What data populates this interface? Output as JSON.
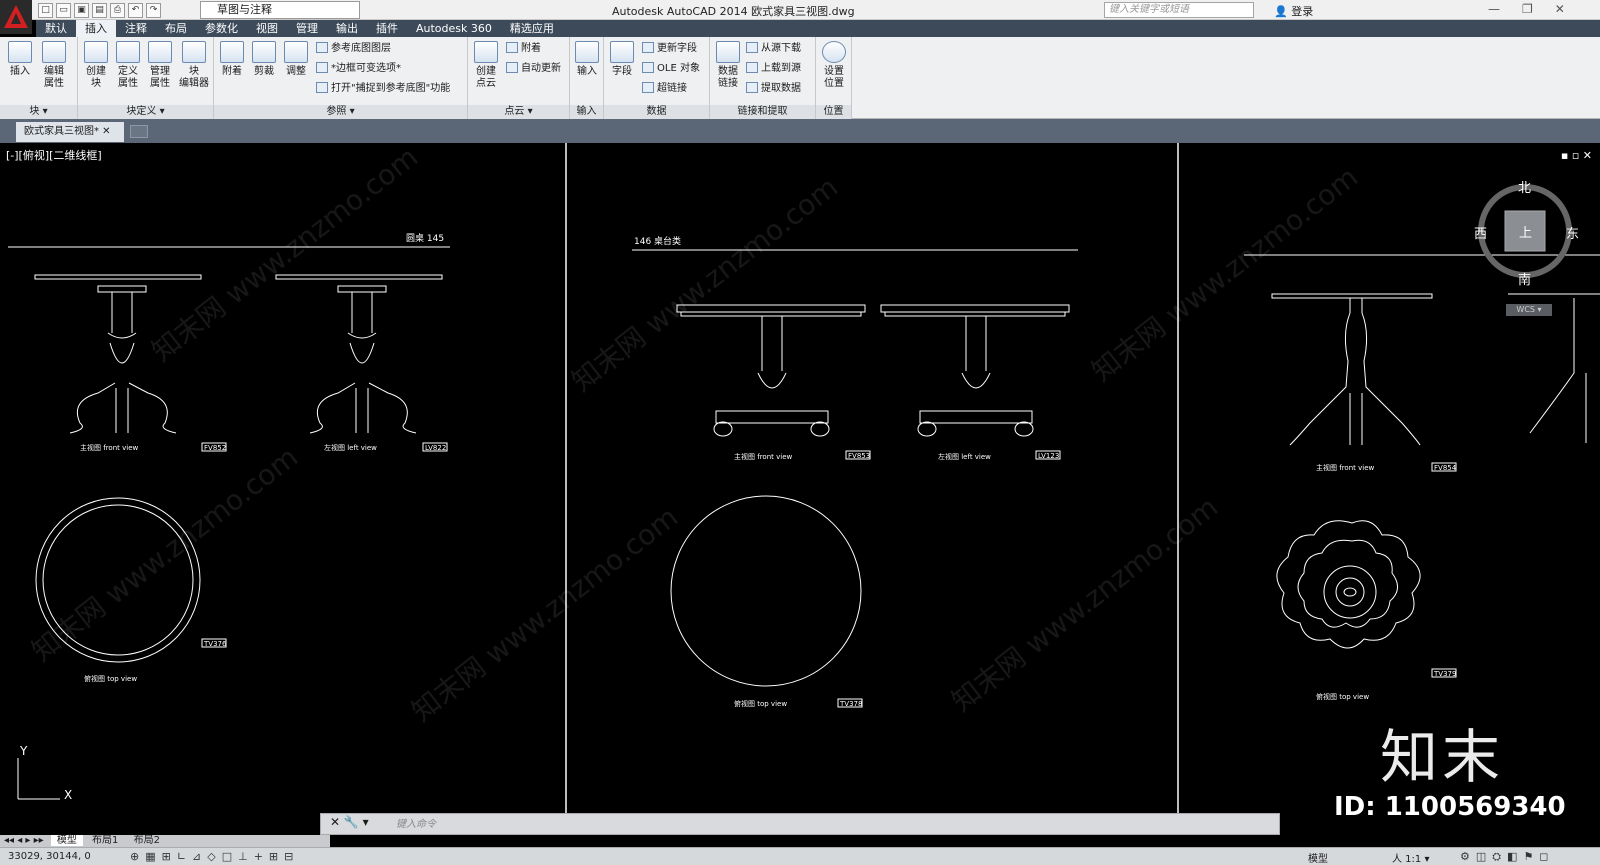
{
  "titlebar": {
    "workspace": "草图与注释",
    "app_title": "Autodesk AutoCAD 2014    欧式家具三视图.dwg",
    "search_placeholder": "键入关键字或短语",
    "login": "登录"
  },
  "menu_tabs": [
    "默认",
    "插入",
    "注释",
    "布局",
    "参数化",
    "视图",
    "管理",
    "输出",
    "插件",
    "Autodesk 360",
    "精选应用"
  ],
  "active_tab": "插入",
  "ribbon": {
    "block": {
      "insert": "插入",
      "edit_attr": "编辑\n属性",
      "footer": "块 ▾"
    },
    "blockdef": {
      "create": "创建\n块",
      "define_attr": "定义\n属性",
      "manage_attr": "管理\n属性",
      "block_editor": "块\n编辑器",
      "footer": "块定义 ▾"
    },
    "reference": {
      "attach": "附着",
      "clip": "剪裁",
      "adjust": "调整",
      "underlay_layers": "参考底图图层",
      "frame_option": "*边框可变选项*",
      "snap_option": "打开\"捕捉到参考底图\"功能",
      "footer": "参照 ▾"
    },
    "pointcloud": {
      "create": "创建\n点云",
      "attach": "附着",
      "autoupdate": "自动更新",
      "footer": "点云 ▾"
    },
    "import": {
      "import": "输入",
      "footer": "输入"
    },
    "data": {
      "field": "字段",
      "update_field": "更新字段",
      "ole": "OLE 对象",
      "hyperlink": "超链接",
      "footer": "数据"
    },
    "linking": {
      "data_link": "数据\n链接",
      "download": "从源下载",
      "upload": "上载到源",
      "extract": "提取数据",
      "footer": "链接和提取"
    },
    "location": {
      "set": "设置\n位置",
      "footer": "位置"
    }
  },
  "doc_tab": "欧式家具三视图*",
  "viewport_label": "[-][俯视][二维线框]",
  "viewport_controls": "▪ ▫ ✕",
  "viewcube": {
    "north": "北",
    "south": "南",
    "east": "东",
    "west": "西",
    "top": "上",
    "wcs": "WCS ▾"
  },
  "drawing": {
    "heading_left": "圆桌  145",
    "heading_mid": "146  桌台类",
    "front_view": "主视图  front view",
    "left_view": "左视图  left view",
    "top_view": "俯视图  top view",
    "tags": [
      "FV852",
      "LV822",
      "TV376",
      "FV853",
      "LV123",
      "TV378",
      "FV854",
      "TV379"
    ],
    "ucs_x": "X",
    "ucs_y": "Y"
  },
  "watermark": "知末网 www.znzmo.com",
  "brand": "知末",
  "brand_id": "ID: 1100569340",
  "command": {
    "placeholder": "键入命令"
  },
  "layout_tabs": [
    "模型",
    "布局1",
    "布局2"
  ],
  "status": {
    "coords": "33029, 30144, 0",
    "model": "模型",
    "scale": "人 1:1 ▾"
  }
}
